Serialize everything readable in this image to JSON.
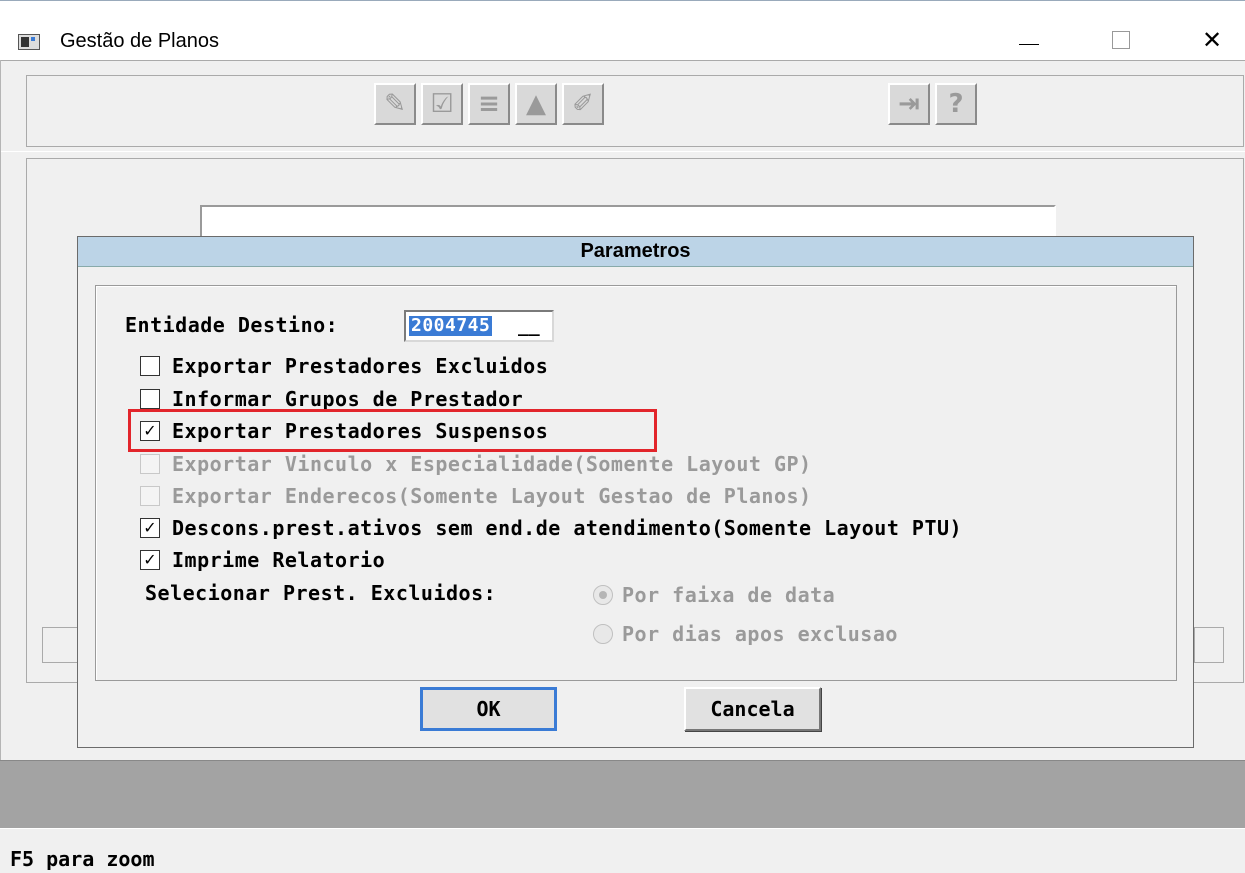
{
  "window": {
    "title": "Gestão de Planos",
    "minimize_glyph": "—",
    "maximize_glyph": "□",
    "close_glyph": "✕"
  },
  "toolbar": {
    "icons": [
      "pencil-icon",
      "checklist-icon",
      "list-icon",
      "upload-icon",
      "edit-icon",
      "exit-icon",
      "help-icon"
    ],
    "glyphs": [
      "✎",
      "☑",
      "≡",
      "▲",
      "✐",
      "⇥",
      "?"
    ]
  },
  "dialog": {
    "title": "Parametros",
    "entidade_label": "Entidade Destino:",
    "entidade_value": "2004745",
    "entidade_fill": "__",
    "options": [
      {
        "label": "Exportar Prestadores Excluidos",
        "checked": false,
        "enabled": true
      },
      {
        "label": "Informar Grupos de Prestador",
        "checked": false,
        "enabled": true
      },
      {
        "label": "Exportar Prestadores Suspensos",
        "checked": true,
        "enabled": true
      },
      {
        "label": "Exportar Vinculo x Especialidade(Somente Layout GP)",
        "checked": false,
        "enabled": false
      },
      {
        "label": "Exportar Enderecos(Somente Layout Gestao de Planos)",
        "checked": false,
        "enabled": false
      },
      {
        "label": "Descons.prest.ativos sem end.de atendimento(Somente Layout PTU)",
        "checked": true,
        "enabled": true
      },
      {
        "label": "Imprime Relatorio",
        "checked": true,
        "enabled": true
      }
    ],
    "selecionar_label": "Selecionar Prest. Excluidos:",
    "radio_options": [
      {
        "label": "Por faixa de data",
        "selected": true,
        "enabled": false
      },
      {
        "label": "Por dias apos exclusao",
        "selected": false,
        "enabled": false
      }
    ],
    "ok_label": "OK",
    "cancel_label": "Cancela",
    "highlight_color": "#e2252b",
    "title_bg": "#bcd4e7"
  },
  "status": {
    "text": "F5 para zoom"
  }
}
